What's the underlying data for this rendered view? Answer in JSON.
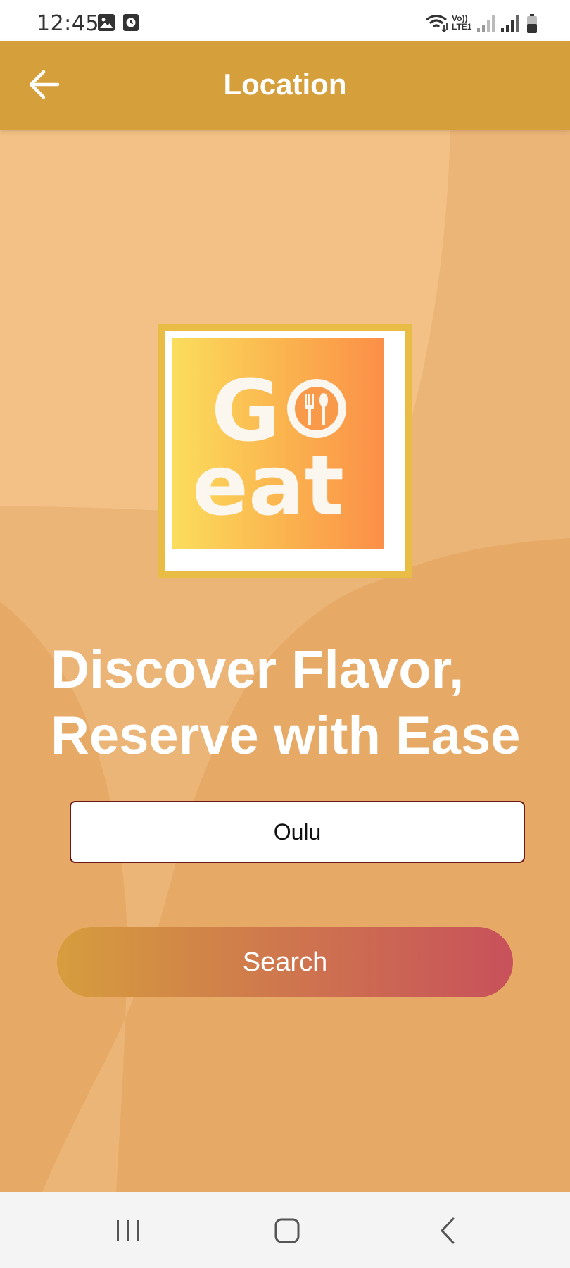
{
  "status_bar": {
    "time": "12:45",
    "left_icons": [
      "image-icon",
      "clock-icon"
    ],
    "network_label": "Vo)) LTE1",
    "right_icons": [
      "wifi-icon",
      "signal-icon",
      "signal-icon",
      "battery-icon"
    ]
  },
  "app_bar": {
    "title": "Location",
    "back_icon": "arrow-left-icon",
    "background_color": "#d59f3b"
  },
  "logo": {
    "text": "Go eat",
    "icon": "fork-spoon-icon"
  },
  "headline": {
    "line1": "Discover Flavor,",
    "line2": "Reserve with Ease"
  },
  "location_field": {
    "value": "Oulu"
  },
  "search_button": {
    "label": "Search",
    "gradient_start": "#d69d3d",
    "gradient_end": "#c8515b"
  },
  "nav_bar": {
    "items": [
      "recent-apps-icon",
      "home-icon",
      "back-icon"
    ]
  },
  "colors": {
    "background": "#e6aa66",
    "accent": "#d59f3b"
  }
}
